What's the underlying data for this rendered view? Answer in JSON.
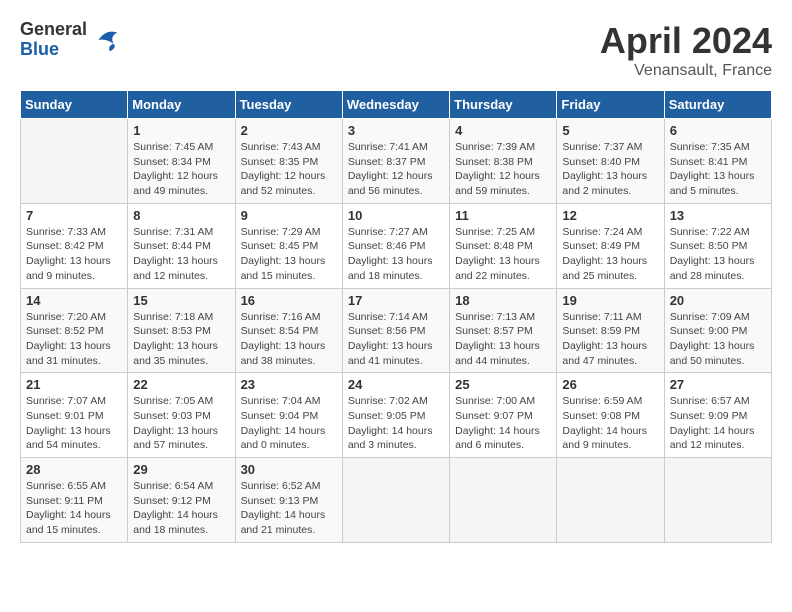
{
  "header": {
    "logo_general": "General",
    "logo_blue": "Blue",
    "month_title": "April 2024",
    "location": "Venansault, France"
  },
  "weekdays": [
    "Sunday",
    "Monday",
    "Tuesday",
    "Wednesday",
    "Thursday",
    "Friday",
    "Saturday"
  ],
  "weeks": [
    [
      {
        "day": "",
        "info": ""
      },
      {
        "day": "1",
        "info": "Sunrise: 7:45 AM\nSunset: 8:34 PM\nDaylight: 12 hours and 49 minutes."
      },
      {
        "day": "2",
        "info": "Sunrise: 7:43 AM\nSunset: 8:35 PM\nDaylight: 12 hours and 52 minutes."
      },
      {
        "day": "3",
        "info": "Sunrise: 7:41 AM\nSunset: 8:37 PM\nDaylight: 12 hours and 56 minutes."
      },
      {
        "day": "4",
        "info": "Sunrise: 7:39 AM\nSunset: 8:38 PM\nDaylight: 12 hours and 59 minutes."
      },
      {
        "day": "5",
        "info": "Sunrise: 7:37 AM\nSunset: 8:40 PM\nDaylight: 13 hours and 2 minutes."
      },
      {
        "day": "6",
        "info": "Sunrise: 7:35 AM\nSunset: 8:41 PM\nDaylight: 13 hours and 5 minutes."
      }
    ],
    [
      {
        "day": "7",
        "info": "Sunrise: 7:33 AM\nSunset: 8:42 PM\nDaylight: 13 hours and 9 minutes."
      },
      {
        "day": "8",
        "info": "Sunrise: 7:31 AM\nSunset: 8:44 PM\nDaylight: 13 hours and 12 minutes."
      },
      {
        "day": "9",
        "info": "Sunrise: 7:29 AM\nSunset: 8:45 PM\nDaylight: 13 hours and 15 minutes."
      },
      {
        "day": "10",
        "info": "Sunrise: 7:27 AM\nSunset: 8:46 PM\nDaylight: 13 hours and 18 minutes."
      },
      {
        "day": "11",
        "info": "Sunrise: 7:25 AM\nSunset: 8:48 PM\nDaylight: 13 hours and 22 minutes."
      },
      {
        "day": "12",
        "info": "Sunrise: 7:24 AM\nSunset: 8:49 PM\nDaylight: 13 hours and 25 minutes."
      },
      {
        "day": "13",
        "info": "Sunrise: 7:22 AM\nSunset: 8:50 PM\nDaylight: 13 hours and 28 minutes."
      }
    ],
    [
      {
        "day": "14",
        "info": "Sunrise: 7:20 AM\nSunset: 8:52 PM\nDaylight: 13 hours and 31 minutes."
      },
      {
        "day": "15",
        "info": "Sunrise: 7:18 AM\nSunset: 8:53 PM\nDaylight: 13 hours and 35 minutes."
      },
      {
        "day": "16",
        "info": "Sunrise: 7:16 AM\nSunset: 8:54 PM\nDaylight: 13 hours and 38 minutes."
      },
      {
        "day": "17",
        "info": "Sunrise: 7:14 AM\nSunset: 8:56 PM\nDaylight: 13 hours and 41 minutes."
      },
      {
        "day": "18",
        "info": "Sunrise: 7:13 AM\nSunset: 8:57 PM\nDaylight: 13 hours and 44 minutes."
      },
      {
        "day": "19",
        "info": "Sunrise: 7:11 AM\nSunset: 8:59 PM\nDaylight: 13 hours and 47 minutes."
      },
      {
        "day": "20",
        "info": "Sunrise: 7:09 AM\nSunset: 9:00 PM\nDaylight: 13 hours and 50 minutes."
      }
    ],
    [
      {
        "day": "21",
        "info": "Sunrise: 7:07 AM\nSunset: 9:01 PM\nDaylight: 13 hours and 54 minutes."
      },
      {
        "day": "22",
        "info": "Sunrise: 7:05 AM\nSunset: 9:03 PM\nDaylight: 13 hours and 57 minutes."
      },
      {
        "day": "23",
        "info": "Sunrise: 7:04 AM\nSunset: 9:04 PM\nDaylight: 14 hours and 0 minutes."
      },
      {
        "day": "24",
        "info": "Sunrise: 7:02 AM\nSunset: 9:05 PM\nDaylight: 14 hours and 3 minutes."
      },
      {
        "day": "25",
        "info": "Sunrise: 7:00 AM\nSunset: 9:07 PM\nDaylight: 14 hours and 6 minutes."
      },
      {
        "day": "26",
        "info": "Sunrise: 6:59 AM\nSunset: 9:08 PM\nDaylight: 14 hours and 9 minutes."
      },
      {
        "day": "27",
        "info": "Sunrise: 6:57 AM\nSunset: 9:09 PM\nDaylight: 14 hours and 12 minutes."
      }
    ],
    [
      {
        "day": "28",
        "info": "Sunrise: 6:55 AM\nSunset: 9:11 PM\nDaylight: 14 hours and 15 minutes."
      },
      {
        "day": "29",
        "info": "Sunrise: 6:54 AM\nSunset: 9:12 PM\nDaylight: 14 hours and 18 minutes."
      },
      {
        "day": "30",
        "info": "Sunrise: 6:52 AM\nSunset: 9:13 PM\nDaylight: 14 hours and 21 minutes."
      },
      {
        "day": "",
        "info": ""
      },
      {
        "day": "",
        "info": ""
      },
      {
        "day": "",
        "info": ""
      },
      {
        "day": "",
        "info": ""
      }
    ]
  ]
}
